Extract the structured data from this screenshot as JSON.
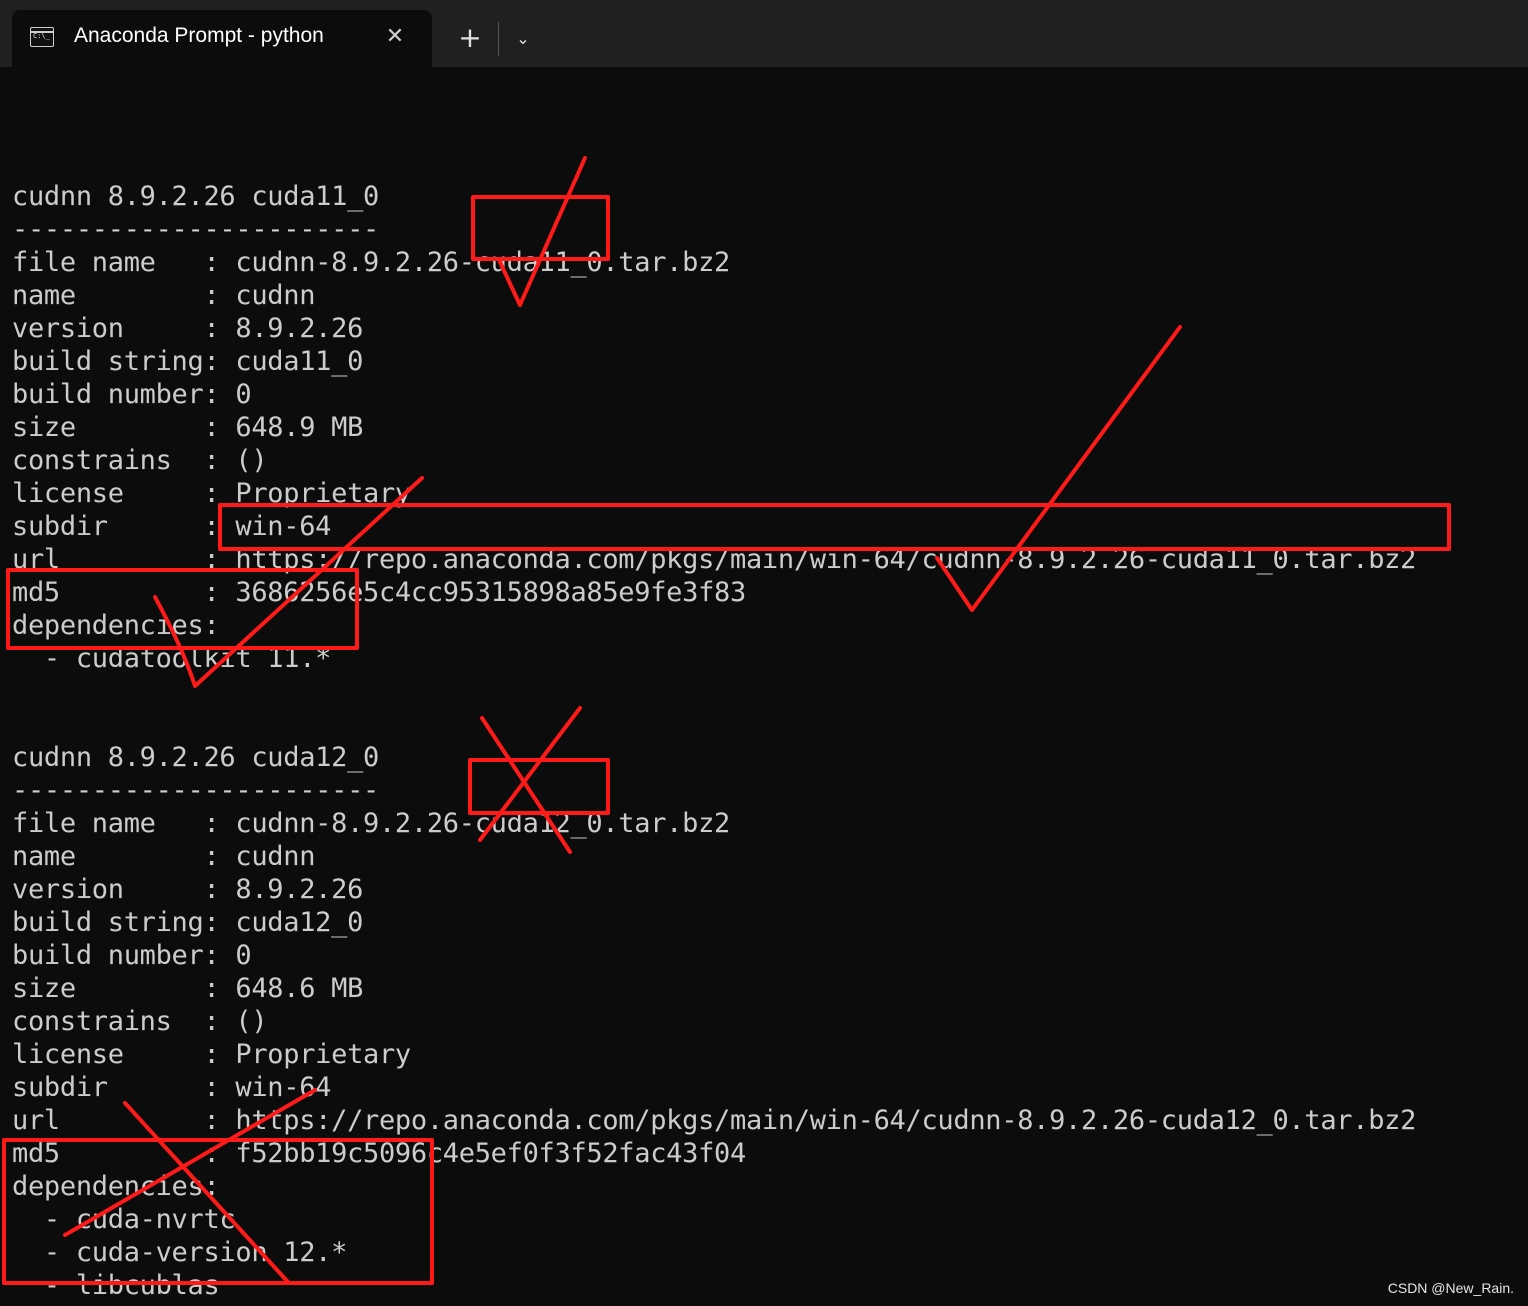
{
  "window": {
    "tab_title": "Anaconda Prompt - python",
    "close_glyph": "✕",
    "new_tab_glyph": "+",
    "dropdown_glyph": "⌄",
    "tab_icon_glyph": "C:\\_"
  },
  "terminal": {
    "lines": [
      "",
      "cudnn 8.9.2.26 cuda11_0",
      "-----------------------",
      "file name   : cudnn-8.9.2.26-cuda11_0.tar.bz2",
      "name        : cudnn",
      "version     : 8.9.2.26",
      "build string: cuda11_0",
      "build number: 0",
      "size        : 648.9 MB",
      "constrains  : ()",
      "license     : Proprietary",
      "subdir      : win-64",
      "url         : https://repo.anaconda.com/pkgs/main/win-64/cudnn-8.9.2.26-cuda11_0.tar.bz2",
      "md5         : 3686256e5c4cc95315898a85e9fe3f83",
      "dependencies:",
      "  - cudatoolkit 11.*",
      "",
      "",
      "cudnn 8.9.2.26 cuda12_0",
      "-----------------------",
      "file name   : cudnn-8.9.2.26-cuda12_0.tar.bz2",
      "name        : cudnn",
      "version     : 8.9.2.26",
      "build string: cuda12_0",
      "build number: 0",
      "size        : 648.6 MB",
      "constrains  : ()",
      "license     : Proprietary",
      "subdir      : win-64",
      "url         : https://repo.anaconda.com/pkgs/main/win-64/cudnn-8.9.2.26-cuda12_0.tar.bz2",
      "md5         : f52bb19c5096c4e5ef0f3f52fac43f04",
      "dependencies:",
      "  - cuda-nvrtc",
      "  - cuda-version 12.*",
      "  - libcublas"
    ]
  },
  "annotation_color": "#ff1a1a",
  "watermark": "CSDN @New_Rain."
}
